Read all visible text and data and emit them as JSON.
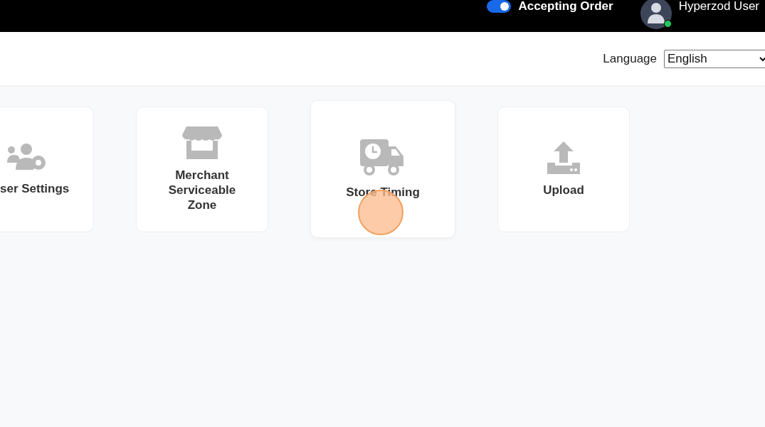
{
  "top_bar": {
    "accepting_order": {
      "label": "Accepting Order",
      "on": true
    },
    "user": {
      "name": "Hyperzod User",
      "status_dot": {
        "color": "#22c55e"
      }
    }
  },
  "toolbar": {
    "language": {
      "label": "Language",
      "value": "English"
    }
  },
  "tiles": [
    {
      "kind": "users-gear",
      "label": "ser Settings",
      "hovered": false
    },
    {
      "kind": "store",
      "label": "Merchant Serviceable Zone",
      "hovered": false
    },
    {
      "kind": "truck-clock",
      "label": "Store Timing",
      "hovered": true
    },
    {
      "kind": "upload",
      "label": "Upload",
      "hovered": false
    }
  ]
}
